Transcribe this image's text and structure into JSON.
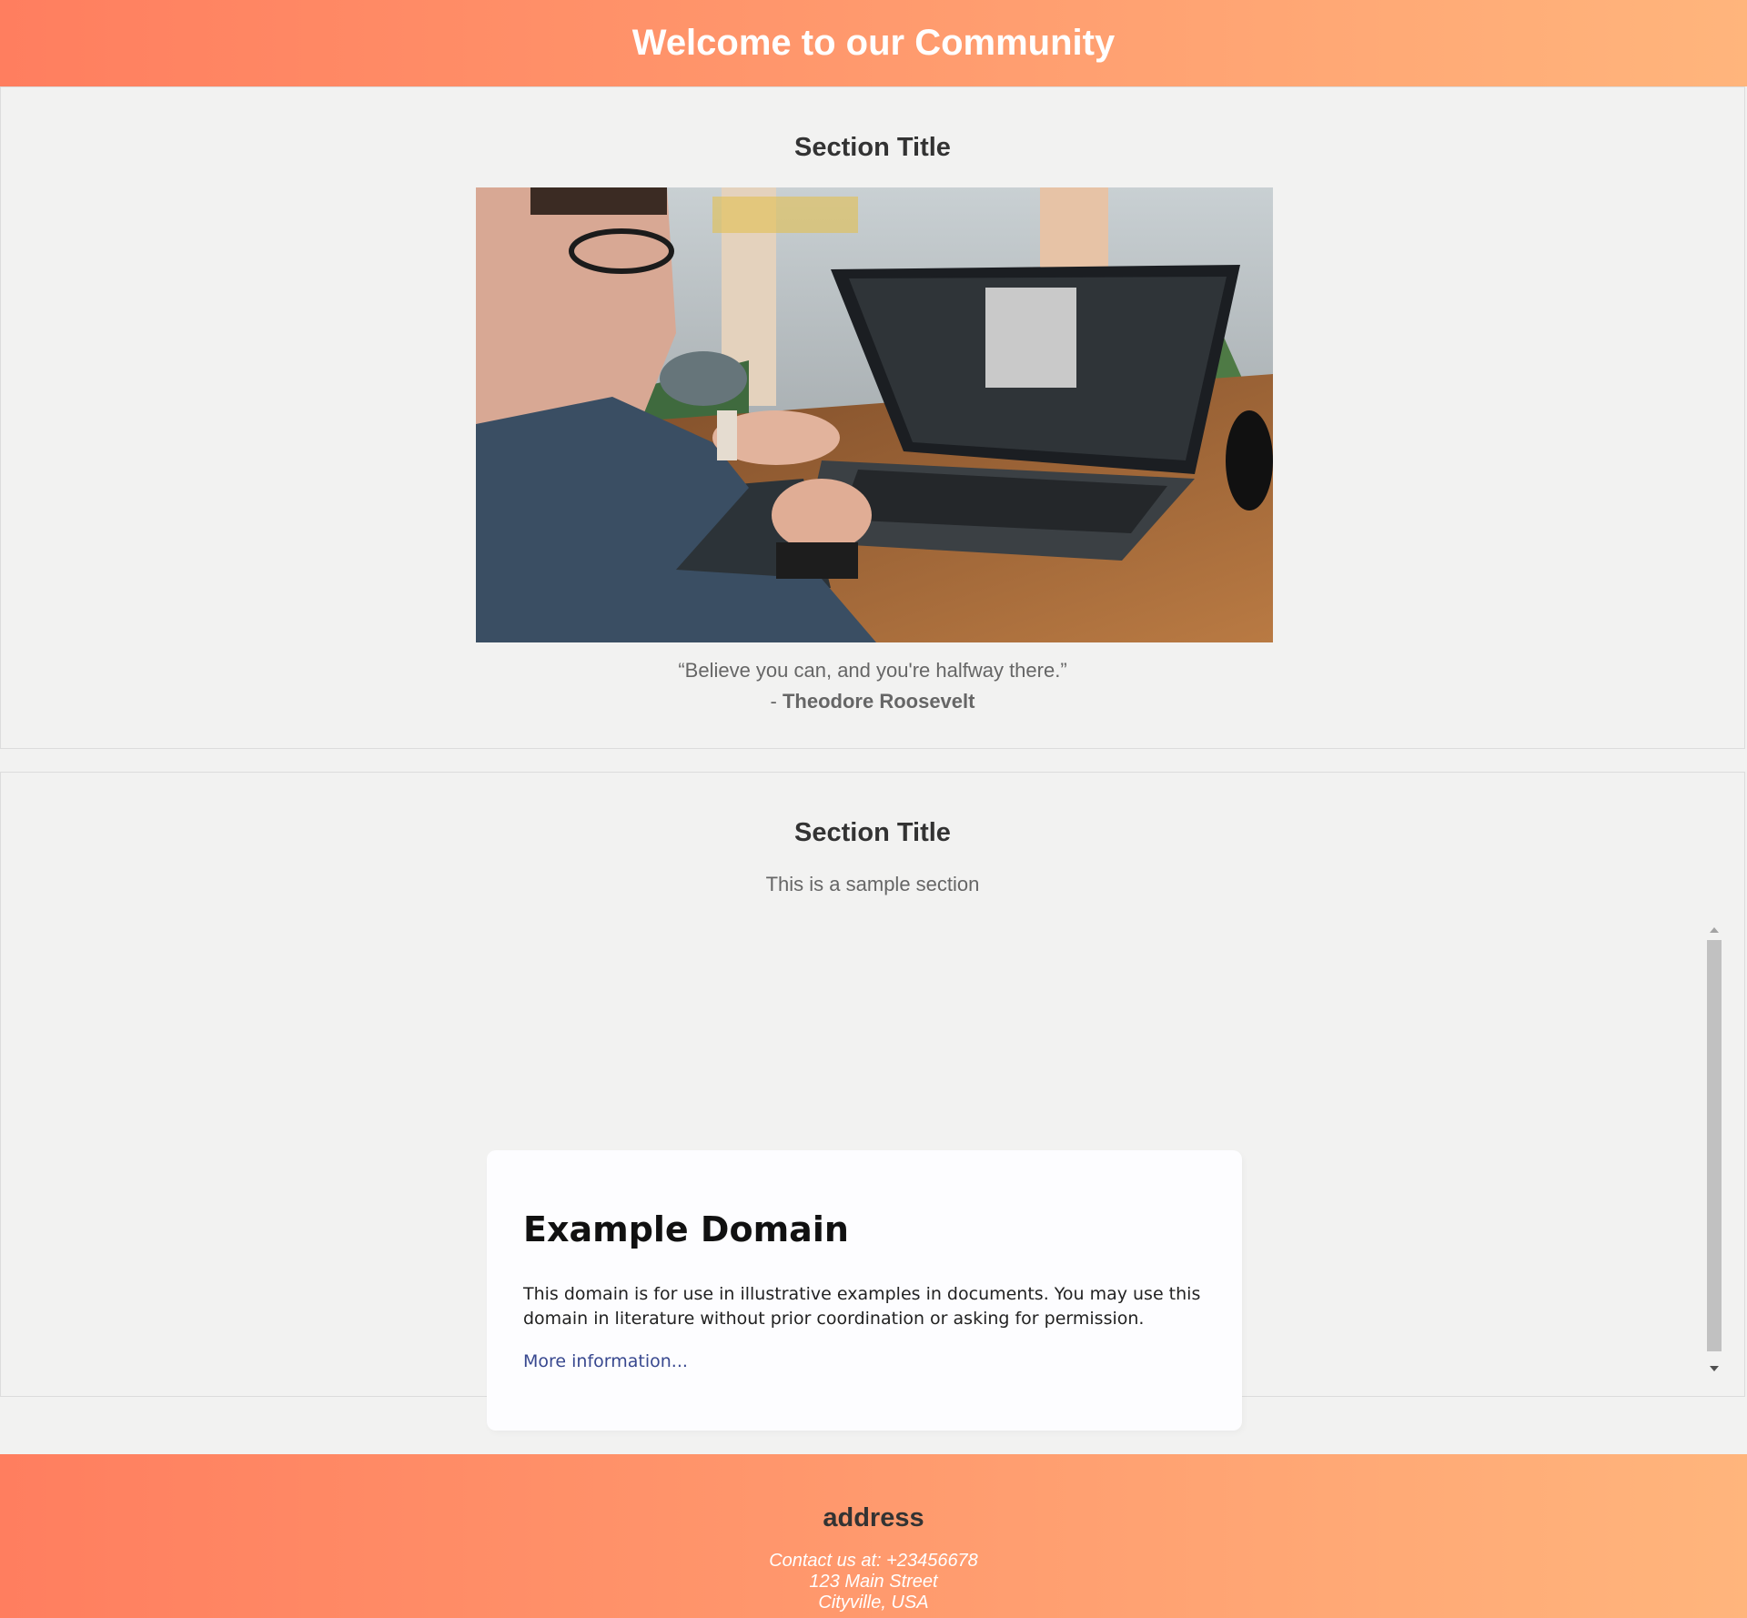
{
  "header": {
    "title": "Welcome to our Community"
  },
  "sections": [
    {
      "title": "Section Title",
      "image_alt": "man working on laptop with drawing tablet",
      "quote": {
        "text": "“Believe you can, and you're halfway there.”",
        "author_prefix": "- ",
        "author": "Theodore Roosevelt"
      }
    },
    {
      "title": "Section Title",
      "text": "This is a sample section",
      "embed": {
        "heading": "Example Domain",
        "paragraph": "This domain is for use in illustrative examples in documents. You may use this domain in literature without prior coordination or asking for permission.",
        "link": "More information..."
      }
    }
  ],
  "footer": {
    "title": "address",
    "contact_line": "Contact us at: +23456678",
    "street": "123 Main Street",
    "city": "Cityville, USA"
  },
  "colors": {
    "gradient_start": "#ff7e5f",
    "gradient_end": "#ffb57c",
    "page_background": "#f2f2f1",
    "link": "#38488f"
  }
}
